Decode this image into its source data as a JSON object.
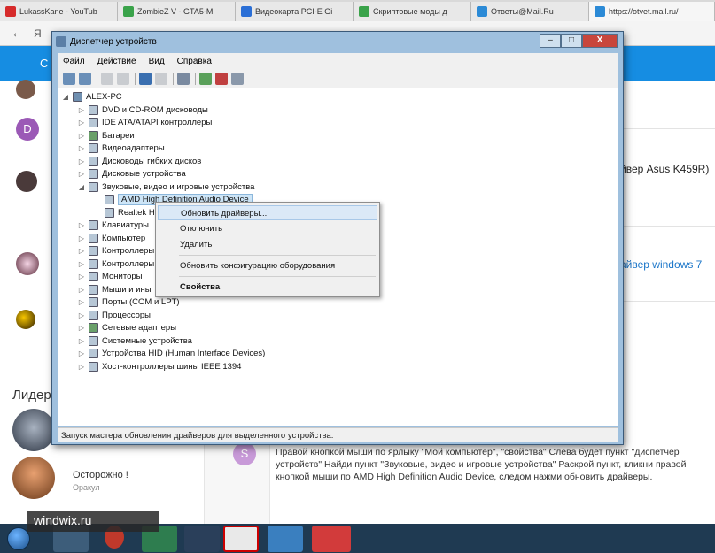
{
  "browser": {
    "tabs": [
      {
        "title": "LukassKane - YouTub",
        "color": "#d62b2b"
      },
      {
        "title": "ZombieZ V - GTA5-M",
        "color": "#3aa34a"
      },
      {
        "title": "Видеокарта PCI-E Gi",
        "color": "#2b6fd6"
      },
      {
        "title": "Скриптовые моды д",
        "color": "#3aa34a"
      },
      {
        "title": "Ответы@Mail.Ru",
        "color": "#2b8ad6"
      },
      {
        "title": "https://otvet.mail.ru/",
        "color": "#2b8ad6"
      }
    ]
  },
  "page": {
    "header_button": "С",
    "left_avatar_letter": "D",
    "leaders_label": "Лидер",
    "leader_name": "Осторожно !",
    "leader_sub": "Оракул",
    "right_text_1": "йвер Asus K459R)",
    "right_link_1": "айвер windows 7",
    "answer_avatar_letter": "S",
    "answer_text": "Правой кнопкой мыши по ярлыку \"Мой компьютер\", \"свойства\" Слева будет пункт \"диспетчер устройств\" Найди пункт \"Звуковые, видео и игровые устройства\" Раскрой пункт, кликни правой кнопкой мыши по AMD High Definition Audio Device, следом нажми обновить драйверы."
  },
  "watermark": "windwix.ru",
  "window": {
    "title": "Диспетчер устройств",
    "controls": {
      "minimize": "–",
      "maximize": "□",
      "close": "X"
    },
    "menu": [
      "Файл",
      "Действие",
      "Вид",
      "Справка"
    ],
    "tree": {
      "root": "ALEX-PC",
      "items": [
        "DVD и CD-ROM дисководы",
        "IDE ATA/ATAPI контроллеры",
        "Батареи",
        "Видеоадаптеры",
        "Дисководы гибких дисков",
        "Дисковые устройства",
        "Звуковые, видео и игровые устройства",
        "AMD High Definition Audio Device",
        "Realtek Hi",
        "Клавиатуры",
        "Компьютер",
        "Контроллеры",
        "Контроллеры",
        "Мониторы",
        "Мыши и ины",
        "Порты (COM и LPT)",
        "Процессоры",
        "Сетевые адаптеры",
        "Системные устройства",
        "Устройства HID (Human Interface Devices)",
        "Хост-контроллеры шины IEEE 1394"
      ]
    },
    "status": "Запуск мастера обновления драйверов для выделенного устройства."
  },
  "context_menu": {
    "items": [
      "Обновить драйверы...",
      "Отключить",
      "Удалить",
      "Обновить конфигурацию оборудования",
      "Свойства"
    ]
  }
}
